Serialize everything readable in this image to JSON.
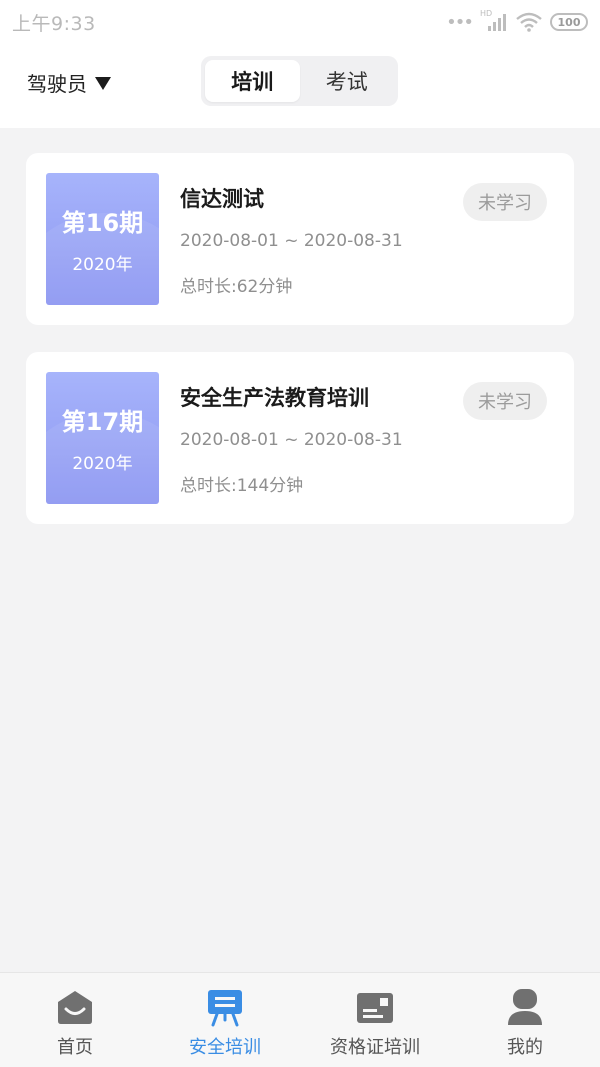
{
  "status_bar": {
    "time": "上午9:33",
    "signal_label": "HD",
    "battery": "100"
  },
  "header": {
    "role": "驾驶员",
    "tabs": [
      {
        "label": "培训",
        "active": true
      },
      {
        "label": "考试",
        "active": false
      }
    ]
  },
  "courses": [
    {
      "period": "第16期",
      "year": "2020年",
      "title": "信达测试",
      "date_range": "2020-08-01 ~ 2020-08-31",
      "duration": "总时长:62分钟",
      "status": "未学习"
    },
    {
      "period": "第17期",
      "year": "2020年",
      "title": "安全生产法教育培训",
      "date_range": "2020-08-01 ~ 2020-08-31",
      "duration": "总时长:144分钟",
      "status": "未学习"
    }
  ],
  "bottom_nav": {
    "items": [
      {
        "label": "首页",
        "icon": "home-icon",
        "active": false
      },
      {
        "label": "安全培训",
        "icon": "training-board-icon",
        "active": true
      },
      {
        "label": "资格证培训",
        "icon": "certificate-icon",
        "active": false
      },
      {
        "label": "我的",
        "icon": "user-icon",
        "active": false
      }
    ]
  },
  "colors": {
    "accent": "#3a8de4",
    "cover_gradient_top": "#a7b4fb",
    "cover_gradient_bottom": "#8b95f1",
    "inactive_icon": "#707070"
  }
}
